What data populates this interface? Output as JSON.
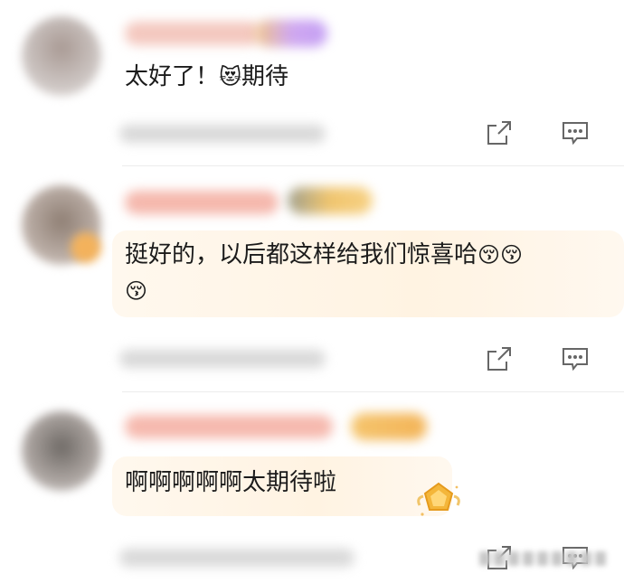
{
  "comments": [
    {
      "text": "太好了！",
      "emoji": "😻",
      "text_after_emoji": "期待",
      "actions": {
        "share_icon": "share-icon",
        "reply_icon": "reply-icon"
      }
    },
    {
      "text": "挺好的，以后都这样给我们惊喜哈",
      "emoji_line_1": "😚😚",
      "emoji_line_2": "😚",
      "actions": {
        "share_icon": "share-icon",
        "reply_icon": "reply-icon"
      }
    },
    {
      "text": "啊啊啊啊啊太期待啦",
      "badge_icon": "pentagon-medal-icon",
      "actions": {
        "share_icon": "share-icon",
        "reply_icon": "reply-icon"
      }
    }
  ],
  "colors": {
    "bubble": "#fff4e4",
    "medal": "#f4b63a",
    "icon": "#666666",
    "divider": "#ececec"
  }
}
